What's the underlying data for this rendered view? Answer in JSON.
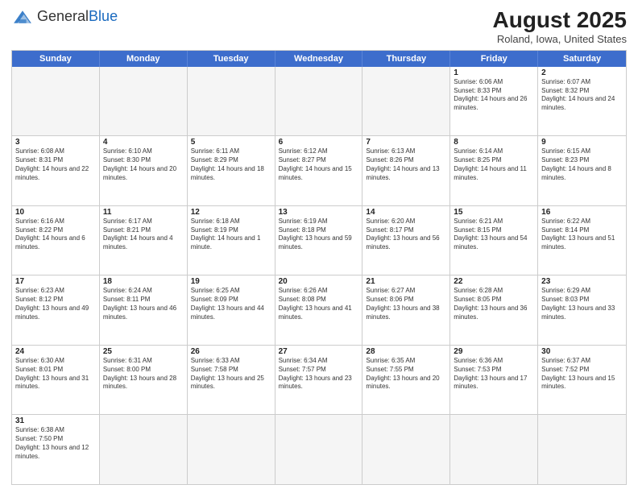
{
  "header": {
    "logo_general": "General",
    "logo_blue": "Blue",
    "title": "August 2025",
    "subtitle": "Roland, Iowa, United States"
  },
  "days_of_week": [
    "Sunday",
    "Monday",
    "Tuesday",
    "Wednesday",
    "Thursday",
    "Friday",
    "Saturday"
  ],
  "weeks": [
    [
      {
        "day": "",
        "info": ""
      },
      {
        "day": "",
        "info": ""
      },
      {
        "day": "",
        "info": ""
      },
      {
        "day": "",
        "info": ""
      },
      {
        "day": "",
        "info": ""
      },
      {
        "day": "1",
        "info": "Sunrise: 6:06 AM\nSunset: 8:33 PM\nDaylight: 14 hours and 26 minutes."
      },
      {
        "day": "2",
        "info": "Sunrise: 6:07 AM\nSunset: 8:32 PM\nDaylight: 14 hours and 24 minutes."
      }
    ],
    [
      {
        "day": "3",
        "info": "Sunrise: 6:08 AM\nSunset: 8:31 PM\nDaylight: 14 hours and 22 minutes."
      },
      {
        "day": "4",
        "info": "Sunrise: 6:10 AM\nSunset: 8:30 PM\nDaylight: 14 hours and 20 minutes."
      },
      {
        "day": "5",
        "info": "Sunrise: 6:11 AM\nSunset: 8:29 PM\nDaylight: 14 hours and 18 minutes."
      },
      {
        "day": "6",
        "info": "Sunrise: 6:12 AM\nSunset: 8:27 PM\nDaylight: 14 hours and 15 minutes."
      },
      {
        "day": "7",
        "info": "Sunrise: 6:13 AM\nSunset: 8:26 PM\nDaylight: 14 hours and 13 minutes."
      },
      {
        "day": "8",
        "info": "Sunrise: 6:14 AM\nSunset: 8:25 PM\nDaylight: 14 hours and 11 minutes."
      },
      {
        "day": "9",
        "info": "Sunrise: 6:15 AM\nSunset: 8:23 PM\nDaylight: 14 hours and 8 minutes."
      }
    ],
    [
      {
        "day": "10",
        "info": "Sunrise: 6:16 AM\nSunset: 8:22 PM\nDaylight: 14 hours and 6 minutes."
      },
      {
        "day": "11",
        "info": "Sunrise: 6:17 AM\nSunset: 8:21 PM\nDaylight: 14 hours and 4 minutes."
      },
      {
        "day": "12",
        "info": "Sunrise: 6:18 AM\nSunset: 8:19 PM\nDaylight: 14 hours and 1 minute."
      },
      {
        "day": "13",
        "info": "Sunrise: 6:19 AM\nSunset: 8:18 PM\nDaylight: 13 hours and 59 minutes."
      },
      {
        "day": "14",
        "info": "Sunrise: 6:20 AM\nSunset: 8:17 PM\nDaylight: 13 hours and 56 minutes."
      },
      {
        "day": "15",
        "info": "Sunrise: 6:21 AM\nSunset: 8:15 PM\nDaylight: 13 hours and 54 minutes."
      },
      {
        "day": "16",
        "info": "Sunrise: 6:22 AM\nSunset: 8:14 PM\nDaylight: 13 hours and 51 minutes."
      }
    ],
    [
      {
        "day": "17",
        "info": "Sunrise: 6:23 AM\nSunset: 8:12 PM\nDaylight: 13 hours and 49 minutes."
      },
      {
        "day": "18",
        "info": "Sunrise: 6:24 AM\nSunset: 8:11 PM\nDaylight: 13 hours and 46 minutes."
      },
      {
        "day": "19",
        "info": "Sunrise: 6:25 AM\nSunset: 8:09 PM\nDaylight: 13 hours and 44 minutes."
      },
      {
        "day": "20",
        "info": "Sunrise: 6:26 AM\nSunset: 8:08 PM\nDaylight: 13 hours and 41 minutes."
      },
      {
        "day": "21",
        "info": "Sunrise: 6:27 AM\nSunset: 8:06 PM\nDaylight: 13 hours and 38 minutes."
      },
      {
        "day": "22",
        "info": "Sunrise: 6:28 AM\nSunset: 8:05 PM\nDaylight: 13 hours and 36 minutes."
      },
      {
        "day": "23",
        "info": "Sunrise: 6:29 AM\nSunset: 8:03 PM\nDaylight: 13 hours and 33 minutes."
      }
    ],
    [
      {
        "day": "24",
        "info": "Sunrise: 6:30 AM\nSunset: 8:01 PM\nDaylight: 13 hours and 31 minutes."
      },
      {
        "day": "25",
        "info": "Sunrise: 6:31 AM\nSunset: 8:00 PM\nDaylight: 13 hours and 28 minutes."
      },
      {
        "day": "26",
        "info": "Sunrise: 6:33 AM\nSunset: 7:58 PM\nDaylight: 13 hours and 25 minutes."
      },
      {
        "day": "27",
        "info": "Sunrise: 6:34 AM\nSunset: 7:57 PM\nDaylight: 13 hours and 23 minutes."
      },
      {
        "day": "28",
        "info": "Sunrise: 6:35 AM\nSunset: 7:55 PM\nDaylight: 13 hours and 20 minutes."
      },
      {
        "day": "29",
        "info": "Sunrise: 6:36 AM\nSunset: 7:53 PM\nDaylight: 13 hours and 17 minutes."
      },
      {
        "day": "30",
        "info": "Sunrise: 6:37 AM\nSunset: 7:52 PM\nDaylight: 13 hours and 15 minutes."
      }
    ],
    [
      {
        "day": "31",
        "info": "Sunrise: 6:38 AM\nSunset: 7:50 PM\nDaylight: 13 hours and 12 minutes."
      },
      {
        "day": "",
        "info": ""
      },
      {
        "day": "",
        "info": ""
      },
      {
        "day": "",
        "info": ""
      },
      {
        "day": "",
        "info": ""
      },
      {
        "day": "",
        "info": ""
      },
      {
        "day": "",
        "info": ""
      }
    ]
  ]
}
